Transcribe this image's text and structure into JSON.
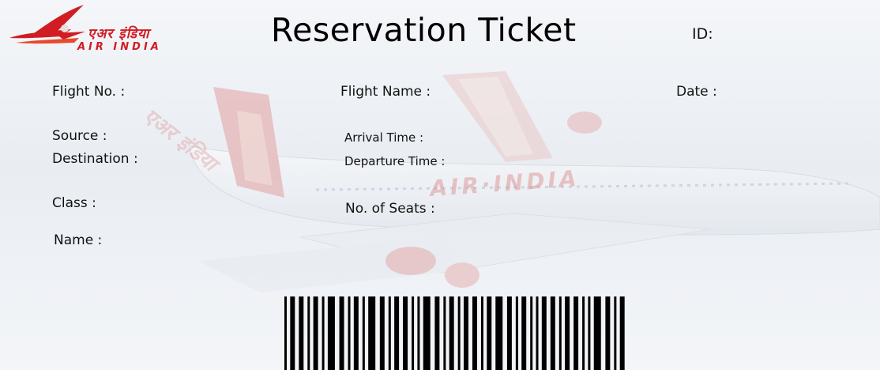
{
  "logo": {
    "hindi_text": "एअर इंडिया",
    "english_text": "AIR INDIA",
    "brand_color": "#d11c24"
  },
  "background": {
    "watermark_text": "AIR·INDIA",
    "fuselage_text": "एअर इंडिया"
  },
  "title": "Reservation Ticket",
  "labels": {
    "id": "ID:",
    "flight_no": "Flight No. :",
    "flight_name": "Flight Name :",
    "date": "Date :",
    "source": "Source :",
    "destination": "Destination :",
    "arrival_time": "Arrival Time :",
    "departure_time": "Departure Time :",
    "class": "Class :",
    "no_of_seats": "No. of Seats :",
    "name": "Name :"
  },
  "barcode": {
    "icon": "barcode-icon",
    "pattern": "1011011010110101110110101101011101101011011010101110110101101011011010110111011010110101011011010110110101011101101011"
  }
}
